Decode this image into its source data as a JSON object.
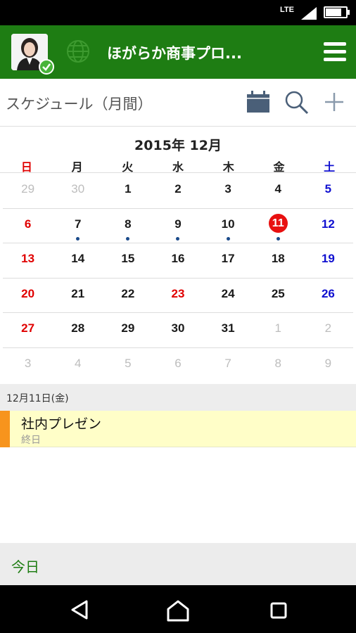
{
  "statusbar": {
    "network": "LTE",
    "battery_level": 0.8
  },
  "appbar": {
    "title": "ほがらか商事プロ..."
  },
  "header": {
    "title": "スケジュール（月間）"
  },
  "calendar": {
    "month_title": "2015年 12月",
    "weekdays": [
      "日",
      "月",
      "火",
      "水",
      "木",
      "金",
      "土"
    ],
    "weeks": [
      [
        {
          "d": "29",
          "other": true
        },
        {
          "d": "30",
          "other": true
        },
        {
          "d": "1"
        },
        {
          "d": "2"
        },
        {
          "d": "3"
        },
        {
          "d": "4"
        },
        {
          "d": "5"
        }
      ],
      [
        {
          "d": "6"
        },
        {
          "d": "7",
          "dot": true
        },
        {
          "d": "8",
          "dot": true
        },
        {
          "d": "9",
          "dot": true
        },
        {
          "d": "10",
          "dot": true
        },
        {
          "d": "11",
          "dot": true,
          "today": true
        },
        {
          "d": "12"
        }
      ],
      [
        {
          "d": "13"
        },
        {
          "d": "14"
        },
        {
          "d": "15"
        },
        {
          "d": "16"
        },
        {
          "d": "17"
        },
        {
          "d": "18"
        },
        {
          "d": "19"
        }
      ],
      [
        {
          "d": "20"
        },
        {
          "d": "21"
        },
        {
          "d": "22"
        },
        {
          "d": "23",
          "holiday": true
        },
        {
          "d": "24"
        },
        {
          "d": "25"
        },
        {
          "d": "26"
        }
      ],
      [
        {
          "d": "27"
        },
        {
          "d": "28"
        },
        {
          "d": "29"
        },
        {
          "d": "30"
        },
        {
          "d": "31"
        },
        {
          "d": "1",
          "other": true
        },
        {
          "d": "2",
          "other": true
        }
      ],
      [
        {
          "d": "3",
          "other": true
        },
        {
          "d": "4",
          "other": true
        },
        {
          "d": "5",
          "other": true
        },
        {
          "d": "6",
          "other": true
        },
        {
          "d": "7",
          "other": true
        },
        {
          "d": "8",
          "other": true
        },
        {
          "d": "9",
          "other": true
        }
      ]
    ]
  },
  "selected": {
    "date_label": "12月11日(金)",
    "events": [
      {
        "title": "社内プレゼン",
        "time": "終日",
        "color": "#f7941d"
      }
    ]
  },
  "footer": {
    "today_label": "今日"
  },
  "colors": {
    "appbar": "#1e7d13",
    "sunday": "#e00000",
    "saturday": "#1010d0",
    "today": "#e81010",
    "event_bg": "#fffec8"
  }
}
